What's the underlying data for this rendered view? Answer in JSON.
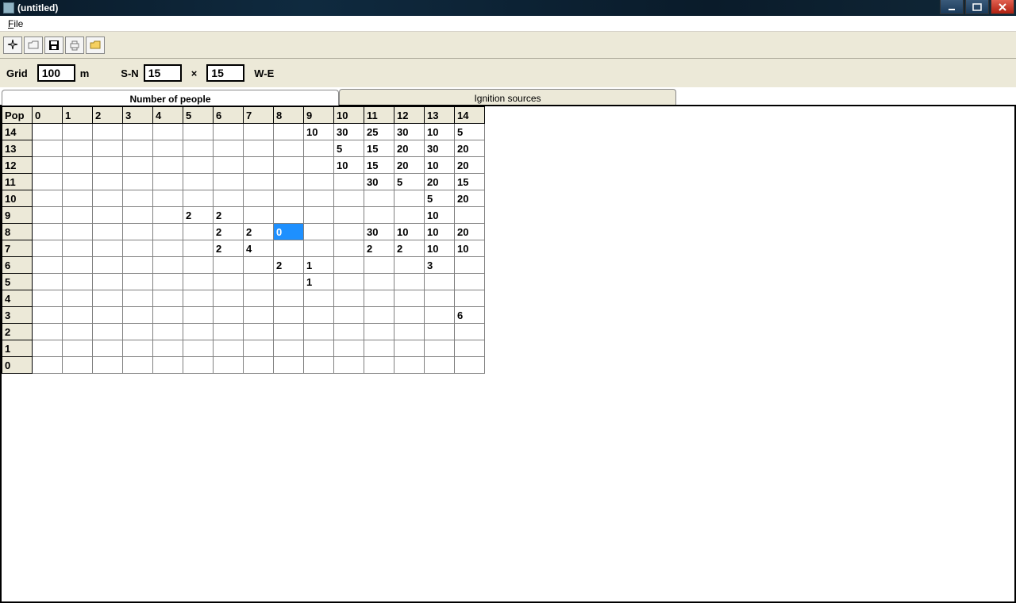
{
  "window": {
    "title": "(untitled)"
  },
  "menu": {
    "file": "File",
    "file_accel": "F"
  },
  "toolbar": {
    "new": "New",
    "open": "Open",
    "save": "Save",
    "print": "Print",
    "folder": "Folder"
  },
  "params": {
    "grid_label": "Grid",
    "grid_value": "100",
    "grid_unit": "m",
    "sn_label": "S-N",
    "sn_value": "15",
    "x_label": "×",
    "we_value": "15",
    "we_label": "W-E"
  },
  "tabs": {
    "people": "Number of people",
    "ignition": "Ignition sources"
  },
  "grid": {
    "corner": "Pop",
    "cols": [
      "0",
      "1",
      "2",
      "3",
      "4",
      "5",
      "6",
      "7",
      "8",
      "9",
      "10",
      "11",
      "12",
      "13",
      "14"
    ],
    "rows": [
      "14",
      "13",
      "12",
      "11",
      "10",
      "9",
      "8",
      "7",
      "6",
      "5",
      "4",
      "3",
      "2",
      "1",
      "0"
    ],
    "selected": {
      "row": "8",
      "col": "8",
      "value": "0"
    },
    "data": {
      "14": {
        "9": "10",
        "10": "30",
        "11": "25",
        "12": "30",
        "13": "10",
        "14": "5"
      },
      "13": {
        "10": "5",
        "11": "15",
        "12": "20",
        "13": "30",
        "14": "20"
      },
      "12": {
        "10": "10",
        "11": "15",
        "12": "20",
        "13": "10",
        "14": "20"
      },
      "11": {
        "11": "30",
        "12": "5",
        "13": "20",
        "14": "15"
      },
      "10": {
        "13": "5",
        "14": "20"
      },
      "9": {
        "5": "2",
        "6": "2",
        "13": "10"
      },
      "8": {
        "6": "2",
        "7": "2",
        "8": "0",
        "11": "30",
        "12": "10",
        "13": "10",
        "14": "20"
      },
      "7": {
        "6": "2",
        "7": "4",
        "11": "2",
        "12": "2",
        "13": "10",
        "14": "10"
      },
      "6": {
        "8": "2",
        "9": "1",
        "13": "3"
      },
      "5": {
        "9": "1"
      },
      "4": {},
      "3": {
        "14": "6"
      },
      "2": {},
      "1": {},
      "0": {}
    }
  }
}
